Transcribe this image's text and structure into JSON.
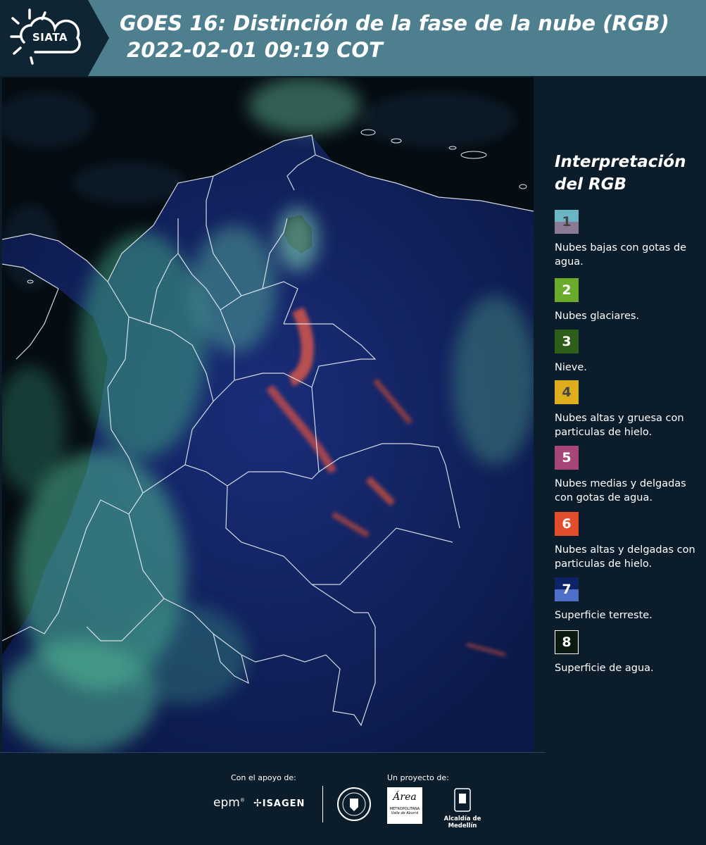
{
  "header": {
    "logo_text": "SIATA",
    "title_line1": "GOES 16: Distinción de la fase de la nube (RGB)",
    "title_line2": " 2022-02-01 09:19 COT"
  },
  "legend": {
    "title_line1": "Interpretación",
    "title_line2": "del RGB",
    "items": [
      {
        "number": "1",
        "label": "Nubes bajas con gotas de agua.",
        "color_top": "#6bb5c4",
        "color_bottom": "#8a7a95"
      },
      {
        "number": "2",
        "label": "Nubes glaciares.",
        "color_top": "#6aab2e",
        "color_bottom": "#6aab2e"
      },
      {
        "number": "3",
        "label": "Nieve.",
        "color_top": "#2e5e1b",
        "color_bottom": "#2e5e1b"
      },
      {
        "number": "4",
        "label": "Nubes altas y gruesa con particulas de hielo.",
        "color_top": "#dfae1f",
        "color_bottom": "#dfae1f"
      },
      {
        "number": "5",
        "label": "Nubes medias y delgadas con gotas de agua.",
        "color_top": "#a64778",
        "color_bottom": "#a64778"
      },
      {
        "number": "6",
        "label": "Nubes altas y delgadas con particulas de hielo.",
        "color_top": "#e24e2c",
        "color_bottom": "#e24e2c"
      },
      {
        "number": "7",
        "label": "Superficie terreste.",
        "color_top": "#0c2368",
        "color_bottom": "#4e70c8"
      },
      {
        "number": "8",
        "label": "Superficie de agua.",
        "color_top": "#0b1a10",
        "color_bottom": "#0b1a10"
      }
    ]
  },
  "footer": {
    "support_label": "Con el apoyo de:",
    "project_label": "Un proyecto de:",
    "sponsor_epm": "epm",
    "sponsor_isagen": "ISAGEN",
    "project_area": "Área",
    "project_area_sub": "METROPOLITANA",
    "project_area_sub2": "Valle de Aburrá",
    "project_alcaldia": "Alcaldía de Medellín"
  },
  "map": {
    "land_color": "#122266",
    "ocean_color": "#060e14",
    "cloud_color": "#4fbf9a"
  }
}
